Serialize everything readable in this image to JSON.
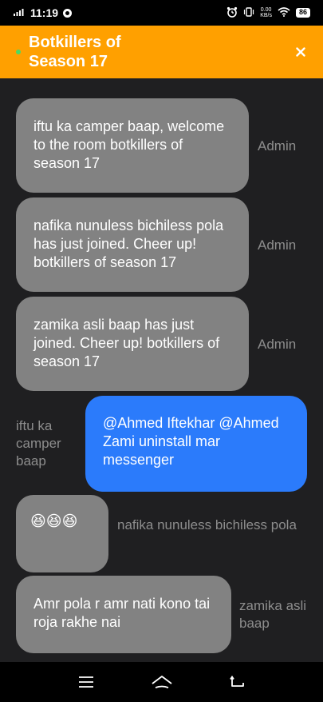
{
  "status_bar": {
    "time": "11:19",
    "network_speed_top": "0.00",
    "network_speed_bottom": "KB/s",
    "battery": "86"
  },
  "header": {
    "title": "Botkillers of Season 17",
    "close_icon": "close-icon",
    "accent_color": "#ffa000"
  },
  "messages": [
    {
      "text": "iftu ka camper baap, welcome to the room botkillers of season 17",
      "sender": "Admin",
      "side": "left"
    },
    {
      "text": "nafika nunuless bichiless pola has just joined. Cheer up! botkillers of season 17",
      "sender": "Admin",
      "side": "left"
    },
    {
      "text": "zamika asli baap has just joined. Cheer up! botkillers of season 17",
      "sender": "Admin",
      "side": "left"
    },
    {
      "text": "@Ahmed Iftekhar @Ahmed Zami uninstall mar messenger",
      "sender": "iftu ka camper baap",
      "side": "right"
    },
    {
      "text": "😆😆😆",
      "sender": "nafika nunuless bichiless pola",
      "side": "left"
    },
    {
      "text": "Amr pola r amr nati kono tai roja rakhe nai",
      "sender": "zamika asli baap",
      "side": "left"
    }
  ],
  "navbar": {
    "menu_icon": "menu-icon",
    "home_icon": "home-icon",
    "back_icon": "back-icon"
  }
}
